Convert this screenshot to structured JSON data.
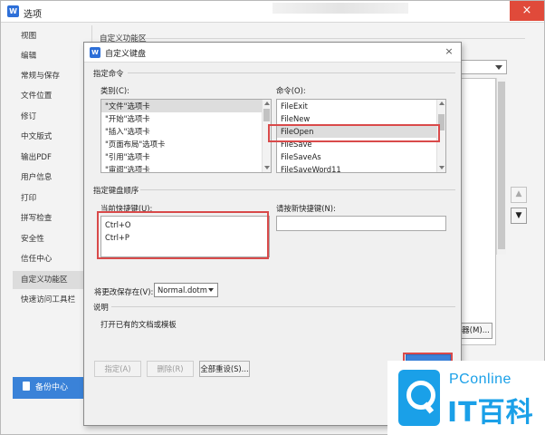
{
  "options_window": {
    "title": "选项",
    "app_logo": "W",
    "close_icon": "×",
    "sidebar": [
      {
        "label": "视图"
      },
      {
        "label": "编辑"
      },
      {
        "label": "常规与保存"
      },
      {
        "label": "文件位置"
      },
      {
        "label": "修订"
      },
      {
        "label": "中文版式"
      },
      {
        "label": "输出PDF"
      },
      {
        "label": "用户信息"
      },
      {
        "label": "打印"
      },
      {
        "label": "拼写检查"
      },
      {
        "label": "安全性"
      },
      {
        "label": "信任中心"
      },
      {
        "label": "自定义功能区",
        "active": true
      },
      {
        "label": "快速访问工具栏"
      }
    ],
    "backup_button": "备份中心",
    "section_title": "自定义功能区",
    "manage_button_partial": "器(M)...",
    "move_up_icon": "▲",
    "move_down_icon": "▼"
  },
  "dialog": {
    "title": "自定义键盘",
    "logo": "W",
    "close_icon": "×",
    "specify_command_group": "指定命令",
    "categories_label": "类别(C):",
    "categories": [
      "\"文件\"选项卡",
      "\"开始\"选项卡",
      "\"插入\"选项卡",
      "\"页面布局\"选项卡",
      "\"引用\"选项卡",
      "\"审阅\"选项卡"
    ],
    "commands_label": "命令(O):",
    "commands": [
      "FileExit",
      "FileNew",
      "FileOpen",
      "FileSave",
      "FileSaveAs",
      "FileSaveWord11"
    ],
    "selected_command": "FileOpen",
    "key_sequence_group": "指定键盘顺序",
    "current_keys_label": "当前快捷键(U):",
    "current_keys": [
      "Ctrl+O",
      "Ctrl+P"
    ],
    "new_key_label": "请按新快捷键(N):",
    "new_key_value": "",
    "save_in_label": "将更改保存在(V):",
    "save_in_value": "Normal.dotm",
    "description_group": "说明",
    "description_text": "打开已有的文档或模板",
    "assign_button": "指定(A)",
    "remove_button": "删除(R)",
    "reset_all_button": "全部重设(S)..."
  },
  "watermark": {
    "top": "PConline",
    "bottom": "IT百科"
  },
  "colors": {
    "highlight": "#d94a4a",
    "accent": "#3a82d8",
    "watermark": "#1aa0e8"
  }
}
